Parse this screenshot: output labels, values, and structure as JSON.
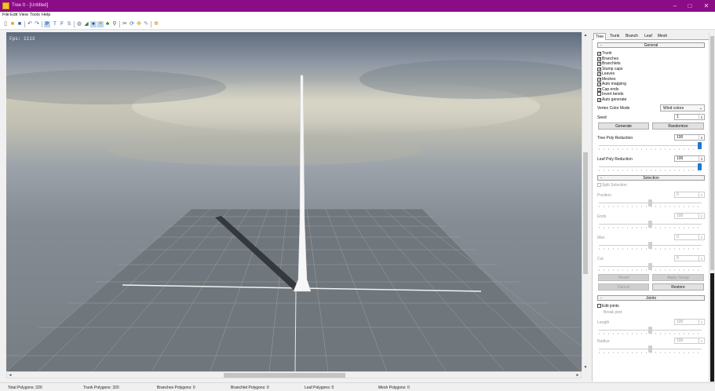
{
  "window": {
    "title": "Tree It - [Untitled]",
    "minimize": "–",
    "maximize": "□",
    "close": "✕"
  },
  "menu": [
    "File",
    "Edit",
    "View",
    "Tools",
    "Help"
  ],
  "toolbar": {
    "icons": [
      "new-icon",
      "open-icon",
      "save-icon",
      "undo-icon",
      "redo-icon",
      "perspective-view-icon",
      "top-view-icon",
      "front-view-icon",
      "side-view-icon",
      "texture-icon",
      "shading-icon",
      "render-sphere-icon",
      "light-icon",
      "leaf-icon",
      "zoom-icon",
      "scissors-icon",
      "rotate-icon",
      "settings-icon",
      "paint-icon",
      "tree-icon"
    ],
    "letters": {
      "p": "P",
      "t": "T",
      "f": "F",
      "s": "S"
    }
  },
  "viewport": {
    "fps": "Fps: 1113"
  },
  "panel": {
    "tabs": [
      "Tree",
      "Trunk",
      "Branch",
      "Leaf",
      "Mesh"
    ],
    "active_tab": "Tree",
    "general": {
      "title": "General",
      "minus": "-",
      "checks": [
        {
          "label": "Trunk",
          "checked": true
        },
        {
          "label": "Branches",
          "checked": true
        },
        {
          "label": "Branchlets",
          "checked": true
        },
        {
          "label": "Stump caps",
          "checked": true
        },
        {
          "label": "Leaves",
          "checked": true
        },
        {
          "label": "Meshes",
          "checked": true
        },
        {
          "label": "Auto mapping",
          "checked": true
        },
        {
          "label": "Cap ends",
          "checked": true
        },
        {
          "label": "Invert bends",
          "checked": false
        },
        {
          "label": "Auto generate",
          "checked": true
        }
      ],
      "vertex_color_label": "Vertex Color Mode",
      "vertex_color_value": "Wind colors",
      "seed_label": "Seed",
      "seed_value": "1",
      "generate": "Generate",
      "randomize": "Randomize",
      "tree_poly_label": "Tree Poly Reduction",
      "tree_poly_value": "100",
      "tree_poly_level": 1.0,
      "leaf_poly_label": "Leaf Poly Reduction",
      "leaf_poly_value": "100",
      "leaf_poly_level": 1.0
    },
    "selection": {
      "title": "Selection",
      "minus": "-",
      "split_label": "Split Selection",
      "fields": [
        {
          "label": "Position",
          "value": "0",
          "level": 0.5
        },
        {
          "label": "Ends",
          "value": "100",
          "level": 0.5
        },
        {
          "label": "Max",
          "value": "0",
          "level": 0.5
        },
        {
          "label": "Cut",
          "value": "0",
          "level": 0.5
        }
      ],
      "reset": "Reset",
      "apply_group": "Apply Group",
      "cancel": "Cancel",
      "restore": "Restore"
    },
    "joints": {
      "title": "Joints",
      "minus": "-",
      "edit_joints": "Edit joints",
      "break_joint": "Break joint",
      "length_label": "Length",
      "length_value": "100",
      "radius_label": "Radius",
      "radius_value": "100"
    }
  },
  "status": {
    "total": "Total Polygons: 320",
    "trunk": "Trunk Polygons: 320",
    "branches": "Branches Polygons: 0",
    "branchlet": "Branchlet Polygons: 0",
    "leaf": "Leaf Polygons: 0",
    "mesh": "Mesh Polygons: 0"
  },
  "arrows": {
    "left": "◄",
    "right": "►",
    "up": "▲",
    "down": "▼",
    "spin": "⇕",
    "combo": "⌄"
  }
}
